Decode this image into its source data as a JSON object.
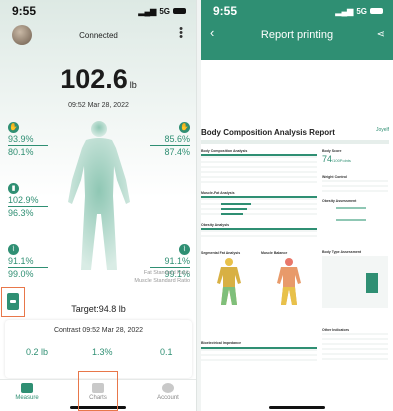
{
  "screen1": {
    "status": {
      "time": "9:55",
      "signal": "5G"
    },
    "header": {
      "connection": "Connected"
    },
    "weight": {
      "value": "102.6",
      "unit": "lb"
    },
    "datetime": "09:52 Mar 28, 2022",
    "metrics_left": [
      {
        "top": "93.9%",
        "bottom": "80.1%"
      },
      {
        "top": "102.9%",
        "bottom": "96.3%"
      },
      {
        "top": "91.1%",
        "bottom": "99.0%"
      }
    ],
    "metrics_right": [
      {
        "top": "85.6%",
        "bottom": "87.4%"
      },
      {
        "top": "91.1%",
        "bottom": "99.1%"
      }
    ],
    "legend": {
      "line1": "Fat Standard Ratio",
      "line2": "Muscle Standard Ratio"
    },
    "target": "Target:94.8 lb",
    "contrast": {
      "title": "Contrast 09:52 Mar 28, 2022",
      "values": [
        "0.2 lb",
        "1.3%",
        "0.1"
      ]
    },
    "nav": [
      {
        "label": "Measure",
        "active": true
      },
      {
        "label": "Charts",
        "active": false
      },
      {
        "label": "Account",
        "active": false
      }
    ],
    "colors": {
      "accent": "#2f8f73",
      "highlight": "#e8774a"
    }
  },
  "screen2": {
    "status": {
      "time": "9:55",
      "signal": "5G"
    },
    "header": {
      "title": "Report printing"
    },
    "report": {
      "title": "Body Composition Analysis Report",
      "logo": "Joyelf",
      "sections": {
        "composition": "Body Composition Analysis",
        "score": "Body Score",
        "muscle_fat": "Muscle-Fat Analysis",
        "weight_control": "Weight Control",
        "obesity": "Obesity Analysis",
        "obesity_assessment": "Obesity Assessment",
        "segmental": "Segmental Fat Analysis",
        "balance": "Muscle Balance",
        "body_type": "Body Type Assessment",
        "impedance": "Bioelectrical Impedance",
        "other": "Other Indicators"
      },
      "score_value": "74",
      "score_unit": "/100Points"
    }
  }
}
